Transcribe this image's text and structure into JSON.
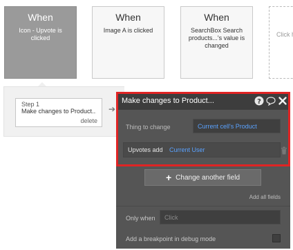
{
  "events": [
    {
      "when": "When",
      "desc": "Icon - Upvote is clicked",
      "selected": true
    },
    {
      "when": "When",
      "desc": "Image A is clicked"
    },
    {
      "when": "When",
      "desc": "SearchBox Search products...'s value is changed"
    },
    {
      "desc": "Click h"
    }
  ],
  "step": {
    "number": "Step 1",
    "title": "Make changes to Product...",
    "delete_label": "delete"
  },
  "editor": {
    "title": "Make changes to Product...",
    "thing_label": "Thing to change",
    "thing_value": "Current cell's Product",
    "field_label": "Upvotes add",
    "field_value": "Current User",
    "change_button_label": "Change another field",
    "add_all_label": "Add all fields",
    "only_when_label": "Only when",
    "only_when_placeholder": "Click",
    "breakpoint_label": "Add a breakpoint in debug mode"
  },
  "colors": {
    "accent_link": "#5aa2ff",
    "highlight": "#e02424",
    "panel_bg": "#555555"
  }
}
